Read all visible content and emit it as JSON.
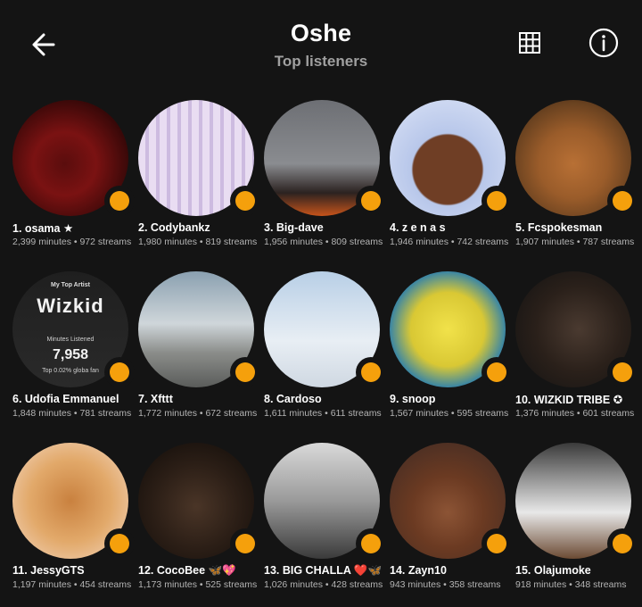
{
  "header": {
    "title": "Oshe",
    "subtitle": "Top listeners"
  },
  "colors": {
    "background": "#141414",
    "badge": "#f5a00c"
  },
  "listeners": [
    {
      "name": "1. osama ★",
      "stats": "2,399 minutes • 972 streams"
    },
    {
      "name": "2. Codybankz",
      "stats": "1,980 minutes • 819 streams"
    },
    {
      "name": "3. Big-dave",
      "stats": "1,956 minutes • 809 streams"
    },
    {
      "name": "4. z e n a s",
      "stats": "1,946 minutes • 742 streams"
    },
    {
      "name": "5. Fcspokesman",
      "stats": "1,907 minutes • 787 streams"
    },
    {
      "name": "6. Udofia Emmanuel",
      "stats": "1,848 minutes • 781 streams"
    },
    {
      "name": "7. Xfttt",
      "stats": "1,772 minutes • 672 streams"
    },
    {
      "name": "8. Cardoso",
      "stats": "1,611 minutes • 611 streams"
    },
    {
      "name": "9. snoop",
      "stats": "1,567 minutes • 595 streams"
    },
    {
      "name": "10. WIZKID TRIBE ✪",
      "stats": "1,376 minutes • 601 streams"
    },
    {
      "name": "11. JessyGTS",
      "stats": "1,197 minutes • 454 streams"
    },
    {
      "name": "12. CocoBee 🦋💖",
      "stats": "1,173 minutes • 525 streams"
    },
    {
      "name": "13. BIG CHALLA ❤️🦋",
      "stats": "1,026 minutes • 428 streams"
    },
    {
      "name": "14. Zayn10",
      "stats": "943 minutes • 358 streams"
    },
    {
      "name": "15. Olajumoke",
      "stats": "918 minutes • 348 streams"
    }
  ],
  "wizkid_card": {
    "top_text": "My Top Artist",
    "artist": "Wizkid",
    "minutes_label": "Minutes Listened",
    "minutes_value": "7,958",
    "bottom_text": "Top 0.02% globa fan"
  }
}
